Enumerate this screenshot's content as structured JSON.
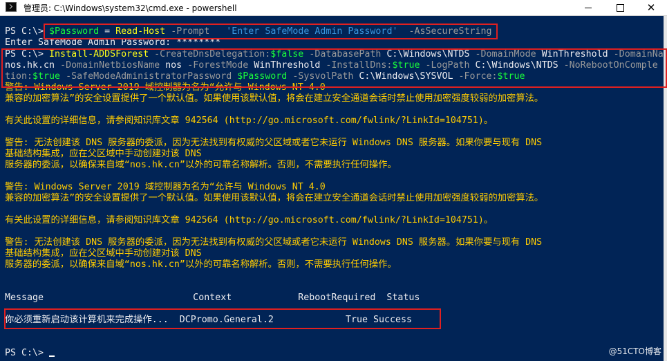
{
  "window": {
    "title": "管理员: C:\\Windows\\system32\\cmd.exe - powershell",
    "minimize_icon": "minimize-icon",
    "maximize_icon": "maximize-icon",
    "close_icon": "close-icon"
  },
  "console": {
    "line1": {
      "prompt": "PS C:\\> ",
      "variable": "$Password",
      "op": " = ",
      "command": "Read-Host",
      "param1": " -Prompt",
      "spaces": "   ",
      "string": "'Enter SafeMode Admin Password'",
      "param2": "  -AsSecureString"
    },
    "line2": "Enter SafeMode Admin Password: ********",
    "cmd_line1": {
      "prompt": "PS C:\\> ",
      "command": "Install-ADDSForest",
      "p1": " -CreateDnsDelegation:",
      "v1": "$false",
      "p2": " -DatabasePath ",
      "a2": "C:\\Windows\\NTDS",
      "p3": " -DomainMode ",
      "a3": "WinThreshold",
      "p4": " -DomainName"
    },
    "cmd_line2": {
      "a4": "nos.hk.cn",
      "p5": " -DomainNetbiosName ",
      "a5": "nos",
      "p6": " -ForestMode ",
      "a6": "WinThreshold",
      "p7": " -InstallDns:",
      "v7": "$true",
      "p8": " -LogPath ",
      "a8": "C:\\Windows\\NTDS",
      "p9": " -NoRebootOnComple"
    },
    "cmd_line3": {
      "p9b": "tion:",
      "v9": "$true",
      "p10": " -SafeModeAdministratorPassword ",
      "v10": "$Password",
      "p11": " -SysvolPath ",
      "a11": "C:\\Windows\\SYSVOL",
      "p12": " -Force:",
      "v12": "$true"
    },
    "warn1a": "警告: Windows Server 2019 域控制器为名为“允许与 Windows NT 4.0",
    "warn1b": "兼容的加密算法”的安全设置提供了一个默认值。如果使用该默认值，将会在建立安全通道会话时禁止使用加密强度较弱的加密算法。",
    "warn1c": "有关此设置的详细信息，请参阅知识库文章 942564 (http://go.microsoft.com/fwlink/?LinkId=104751)。",
    "warn2a": "警告: 无法创建该 DNS 服务器的委派，因为无法找到有权威的父区域或者它未运行 Windows DNS 服务器。如果你要与现有 DNS",
    "warn2b": "基础结构集成，应在父区域中手动创建对该 DNS",
    "warn2c": "服务器的委派，以确保来自域“nos.hk.cn”以外的可靠名称解析。否则，不需要执行任何操作。",
    "warn3a": "警告: Windows Server 2019 域控制器为名为“允许与 Windows NT 4.0",
    "warn3b": "兼容的加密算法”的安全设置提供了一个默认值。如果使用该默认值，将会在建立安全通道会话时禁止使用加密强度较弱的加密算法。",
    "warn3c": "有关此设置的详细信息，请参阅知识库文章 942564 (http://go.microsoft.com/fwlink/?LinkId=104751)。",
    "warn4a": "警告: 无法创建该 DNS 服务器的委派，因为无法找到有权威的父区域或者它未运行 Windows DNS 服务器。如果你要与现有 DNS",
    "warn4b": "基础结构集成，应在父区域中手动创建对该 DNS",
    "warn4c": "服务器的委派，以确保来自域“nos.hk.cn”以外的可靠名称解析。否则，不需要执行任何操作。",
    "table": {
      "header": "Message                           Context            RebootRequired  Status",
      "row": "你必须重新启动该计算机来完成操作...  DCPromo.General.2             True Success"
    },
    "final_prompt": "PS C:\\> "
  },
  "watermark": "@51CTO博客",
  "colors": {
    "background": "#012456",
    "command": "#fdfd1a",
    "variable": "#1afc3b",
    "parameter": "#9a9a9a",
    "string": "#3a96dd",
    "warning": "#ffcc00",
    "annotation": "#e02020"
  }
}
